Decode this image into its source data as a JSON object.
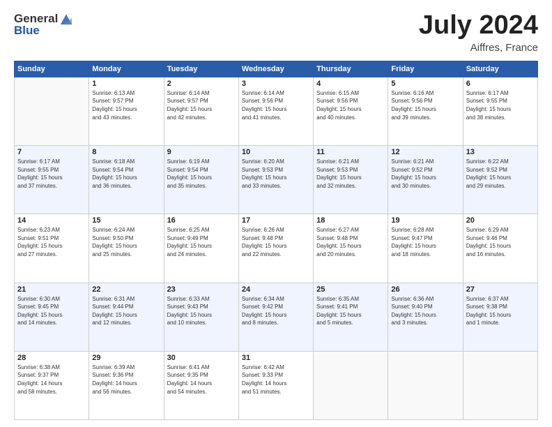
{
  "header": {
    "logo_general": "General",
    "logo_blue": "Blue",
    "title": "July 2024",
    "location": "Aiffres, France"
  },
  "days_of_week": [
    "Sunday",
    "Monday",
    "Tuesday",
    "Wednesday",
    "Thursday",
    "Friday",
    "Saturday"
  ],
  "weeks": [
    [
      {
        "day": "",
        "sunrise": "",
        "sunset": "",
        "daylight": ""
      },
      {
        "day": "1",
        "sunrise": "Sunrise: 6:13 AM",
        "sunset": "Sunset: 9:57 PM",
        "daylight": "Daylight: 15 hours and 43 minutes."
      },
      {
        "day": "2",
        "sunrise": "Sunrise: 6:14 AM",
        "sunset": "Sunset: 9:57 PM",
        "daylight": "Daylight: 15 hours and 42 minutes."
      },
      {
        "day": "3",
        "sunrise": "Sunrise: 6:14 AM",
        "sunset": "Sunset: 9:56 PM",
        "daylight": "Daylight: 15 hours and 41 minutes."
      },
      {
        "day": "4",
        "sunrise": "Sunrise: 6:15 AM",
        "sunset": "Sunset: 9:56 PM",
        "daylight": "Daylight: 15 hours and 40 minutes."
      },
      {
        "day": "5",
        "sunrise": "Sunrise: 6:16 AM",
        "sunset": "Sunset: 9:56 PM",
        "daylight": "Daylight: 15 hours and 39 minutes."
      },
      {
        "day": "6",
        "sunrise": "Sunrise: 6:17 AM",
        "sunset": "Sunset: 9:55 PM",
        "daylight": "Daylight: 15 hours and 38 minutes."
      }
    ],
    [
      {
        "day": "7",
        "sunrise": "Sunrise: 6:17 AM",
        "sunset": "Sunset: 9:55 PM",
        "daylight": "Daylight: 15 hours and 37 minutes."
      },
      {
        "day": "8",
        "sunrise": "Sunrise: 6:18 AM",
        "sunset": "Sunset: 9:54 PM",
        "daylight": "Daylight: 15 hours and 36 minutes."
      },
      {
        "day": "9",
        "sunrise": "Sunrise: 6:19 AM",
        "sunset": "Sunset: 9:54 PM",
        "daylight": "Daylight: 15 hours and 35 minutes."
      },
      {
        "day": "10",
        "sunrise": "Sunrise: 6:20 AM",
        "sunset": "Sunset: 9:53 PM",
        "daylight": "Daylight: 15 hours and 33 minutes."
      },
      {
        "day": "11",
        "sunrise": "Sunrise: 6:21 AM",
        "sunset": "Sunset: 9:53 PM",
        "daylight": "Daylight: 15 hours and 32 minutes."
      },
      {
        "day": "12",
        "sunrise": "Sunrise: 6:21 AM",
        "sunset": "Sunset: 9:52 PM",
        "daylight": "Daylight: 15 hours and 30 minutes."
      },
      {
        "day": "13",
        "sunrise": "Sunrise: 6:22 AM",
        "sunset": "Sunset: 9:52 PM",
        "daylight": "Daylight: 15 hours and 29 minutes."
      }
    ],
    [
      {
        "day": "14",
        "sunrise": "Sunrise: 6:23 AM",
        "sunset": "Sunset: 9:51 PM",
        "daylight": "Daylight: 15 hours and 27 minutes."
      },
      {
        "day": "15",
        "sunrise": "Sunrise: 6:24 AM",
        "sunset": "Sunset: 9:50 PM",
        "daylight": "Daylight: 15 hours and 25 minutes."
      },
      {
        "day": "16",
        "sunrise": "Sunrise: 6:25 AM",
        "sunset": "Sunset: 9:49 PM",
        "daylight": "Daylight: 15 hours and 24 minutes."
      },
      {
        "day": "17",
        "sunrise": "Sunrise: 6:26 AM",
        "sunset": "Sunset: 9:48 PM",
        "daylight": "Daylight: 15 hours and 22 minutes."
      },
      {
        "day": "18",
        "sunrise": "Sunrise: 6:27 AM",
        "sunset": "Sunset: 9:48 PM",
        "daylight": "Daylight: 15 hours and 20 minutes."
      },
      {
        "day": "19",
        "sunrise": "Sunrise: 6:28 AM",
        "sunset": "Sunset: 9:47 PM",
        "daylight": "Daylight: 15 hours and 18 minutes."
      },
      {
        "day": "20",
        "sunrise": "Sunrise: 6:29 AM",
        "sunset": "Sunset: 9:46 PM",
        "daylight": "Daylight: 15 hours and 16 minutes."
      }
    ],
    [
      {
        "day": "21",
        "sunrise": "Sunrise: 6:30 AM",
        "sunset": "Sunset: 9:45 PM",
        "daylight": "Daylight: 15 hours and 14 minutes."
      },
      {
        "day": "22",
        "sunrise": "Sunrise: 6:31 AM",
        "sunset": "Sunset: 9:44 PM",
        "daylight": "Daylight: 15 hours and 12 minutes."
      },
      {
        "day": "23",
        "sunrise": "Sunrise: 6:33 AM",
        "sunset": "Sunset: 9:43 PM",
        "daylight": "Daylight: 15 hours and 10 minutes."
      },
      {
        "day": "24",
        "sunrise": "Sunrise: 6:34 AM",
        "sunset": "Sunset: 9:42 PM",
        "daylight": "Daylight: 15 hours and 8 minutes."
      },
      {
        "day": "25",
        "sunrise": "Sunrise: 6:35 AM",
        "sunset": "Sunset: 9:41 PM",
        "daylight": "Daylight: 15 hours and 5 minutes."
      },
      {
        "day": "26",
        "sunrise": "Sunrise: 6:36 AM",
        "sunset": "Sunset: 9:40 PM",
        "daylight": "Daylight: 15 hours and 3 minutes."
      },
      {
        "day": "27",
        "sunrise": "Sunrise: 6:37 AM",
        "sunset": "Sunset: 9:38 PM",
        "daylight": "Daylight: 15 hours and 1 minute."
      }
    ],
    [
      {
        "day": "28",
        "sunrise": "Sunrise: 6:38 AM",
        "sunset": "Sunset: 9:37 PM",
        "daylight": "Daylight: 14 hours and 58 minutes."
      },
      {
        "day": "29",
        "sunrise": "Sunrise: 6:39 AM",
        "sunset": "Sunset: 9:36 PM",
        "daylight": "Daylight: 14 hours and 56 minutes."
      },
      {
        "day": "30",
        "sunrise": "Sunrise: 6:41 AM",
        "sunset": "Sunset: 9:35 PM",
        "daylight": "Daylight: 14 hours and 54 minutes."
      },
      {
        "day": "31",
        "sunrise": "Sunrise: 6:42 AM",
        "sunset": "Sunset: 9:33 PM",
        "daylight": "Daylight: 14 hours and 51 minutes."
      },
      {
        "day": "",
        "sunrise": "",
        "sunset": "",
        "daylight": ""
      },
      {
        "day": "",
        "sunrise": "",
        "sunset": "",
        "daylight": ""
      },
      {
        "day": "",
        "sunrise": "",
        "sunset": "",
        "daylight": ""
      }
    ]
  ]
}
